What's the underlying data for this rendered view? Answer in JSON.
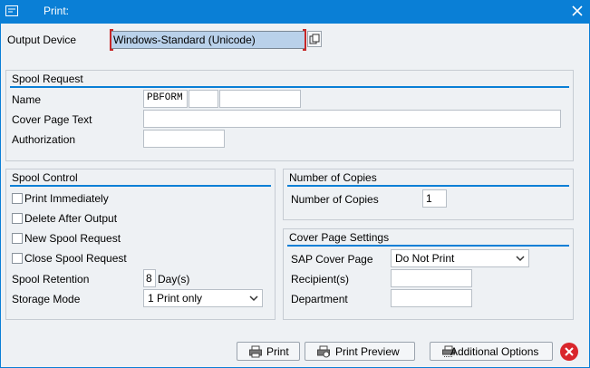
{
  "window": {
    "title": "Print:",
    "accent_color": "#0a7fd6"
  },
  "output_device": {
    "label": "Output Device",
    "value": "Windows-Standard (Unicode)"
  },
  "spool_request": {
    "title": "Spool Request",
    "name_label": "Name",
    "name_part1": "PBFORM",
    "name_part2": "",
    "name_part3": "",
    "cover_page_text_label": "Cover Page Text",
    "cover_page_text_value": "",
    "authorization_label": "Authorization",
    "authorization_value": ""
  },
  "spool_control": {
    "title": "Spool Control",
    "print_immediately": "Print Immediately",
    "delete_after_output": "Delete After Output",
    "new_spool_request": "New Spool Request",
    "close_spool_request": "Close Spool Request",
    "spool_retention_label": "Spool Retention",
    "spool_retention_value": "8",
    "spool_retention_unit": "Day(s)",
    "storage_mode_label": "Storage Mode",
    "storage_mode_value": "1 Print only"
  },
  "number_of_copies": {
    "title": "Number of Copies",
    "label": "Number of Copies",
    "value": "1"
  },
  "cover_page_settings": {
    "title": "Cover Page Settings",
    "sap_cover_page_label": "SAP Cover Page",
    "sap_cover_page_value": "Do Not Print",
    "recipients_label": "Recipient(s)",
    "recipients_value": "",
    "department_label": "Department",
    "department_value": ""
  },
  "buttons": {
    "print": "Print",
    "print_preview": "Print Preview",
    "additional_options": "Additional Options"
  },
  "icons": {
    "title": "window-edit-icon",
    "close": "close-icon",
    "search_help": "search-help-icon",
    "print": "printer-icon",
    "print_preview": "print-preview-icon",
    "additional_options": "options-icon",
    "cancel": "cancel-icon"
  }
}
